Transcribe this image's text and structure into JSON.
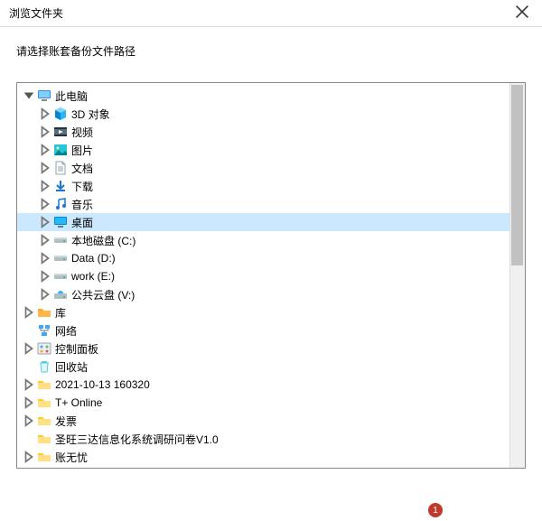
{
  "dialog": {
    "title": "浏览文件夹",
    "instruction": "请选择账套备份文件路径"
  },
  "tree": [
    {
      "depth": 0,
      "toggle": "expanded",
      "icon": "monitor",
      "label": "此电脑"
    },
    {
      "depth": 1,
      "toggle": "collapsed",
      "icon": "3dobjects",
      "label": "3D 对象"
    },
    {
      "depth": 1,
      "toggle": "collapsed",
      "icon": "video",
      "label": "视频"
    },
    {
      "depth": 1,
      "toggle": "collapsed",
      "icon": "pictures",
      "label": "图片"
    },
    {
      "depth": 1,
      "toggle": "collapsed",
      "icon": "documents",
      "label": "文档"
    },
    {
      "depth": 1,
      "toggle": "collapsed",
      "icon": "downloads",
      "label": "下载"
    },
    {
      "depth": 1,
      "toggle": "collapsed",
      "icon": "music",
      "label": "音乐"
    },
    {
      "depth": 1,
      "toggle": "collapsed",
      "icon": "desktop",
      "label": "桌面",
      "selected": true
    },
    {
      "depth": 1,
      "toggle": "collapsed",
      "icon": "drive",
      "label": "本地磁盘 (C:)"
    },
    {
      "depth": 1,
      "toggle": "collapsed",
      "icon": "drive",
      "label": "Data (D:)"
    },
    {
      "depth": 1,
      "toggle": "collapsed",
      "icon": "drive",
      "label": "work (E:)"
    },
    {
      "depth": 1,
      "toggle": "collapsed",
      "icon": "clouddrive",
      "label": "公共云盘 (V:)"
    },
    {
      "depth": 0,
      "toggle": "collapsed",
      "icon": "libraries",
      "label": "库"
    },
    {
      "depth": 0,
      "toggle": "none",
      "icon": "network",
      "label": "网络"
    },
    {
      "depth": 0,
      "toggle": "collapsed",
      "icon": "controlpanel",
      "label": "控制面板"
    },
    {
      "depth": 0,
      "toggle": "none",
      "icon": "recyclebin",
      "label": "回收站"
    },
    {
      "depth": 0,
      "toggle": "collapsed",
      "icon": "folder",
      "label": "2021-10-13 160320"
    },
    {
      "depth": 0,
      "toggle": "collapsed",
      "icon": "folder",
      "label": "T+ Online"
    },
    {
      "depth": 0,
      "toggle": "collapsed",
      "icon": "folder",
      "label": "发票"
    },
    {
      "depth": 0,
      "toggle": "none",
      "icon": "folder",
      "label": "圣旺三达信息化系统调研问卷V1.0"
    },
    {
      "depth": 0,
      "toggle": "collapsed",
      "icon": "folder",
      "label": "账无忧"
    }
  ],
  "footer": {
    "marker": "1"
  }
}
